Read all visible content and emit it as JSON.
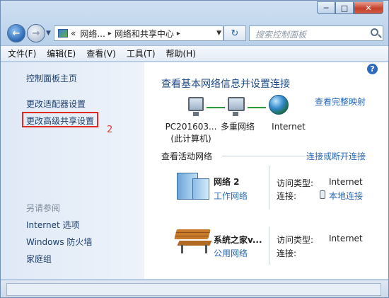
{
  "window": {
    "min_glyph": "─",
    "max_glyph": "□",
    "close_glyph": "✕"
  },
  "nav": {
    "back_glyph": "←",
    "forward_glyph": "→",
    "refresh_glyph": "↻",
    "breadcrumb_prefix": "«",
    "breadcrumb": [
      "网络...",
      "网络和共享中心"
    ],
    "breadcrumb_sep": "▸",
    "search_placeholder": "搜索控制面板"
  },
  "menu": [
    "文件(F)",
    "编辑(E)",
    "查看(V)",
    "工具(T)",
    "帮助(H)"
  ],
  "sidebar": {
    "home": "控制面板主页",
    "links": [
      "更改适配器设置",
      "更改高级共享设置"
    ],
    "annotation": "2",
    "see_also_heading": "另请参阅",
    "see_also": [
      "Internet 选项",
      "Windows 防火墙",
      "家庭组"
    ]
  },
  "main": {
    "help_glyph": "?",
    "heading": "查看基本网络信息并设置连接",
    "full_map_link": "查看完整映射",
    "map_nodes": [
      {
        "line1": "PC201603...",
        "line2": "(此计算机)"
      },
      {
        "line1": "多重网络",
        "line2": ""
      },
      {
        "line1": "Internet",
        "line2": ""
      }
    ],
    "active_label": "查看活动网络",
    "connect_link": "连接或断开连接",
    "networks": [
      {
        "name": "网络  2",
        "type_link": "工作网络",
        "access_label": "访问类型:",
        "access_value": "Internet",
        "conn_label": "连接:",
        "conn_value": "本地连接",
        "icon": "building-icon"
      },
      {
        "name": "系统之家v...",
        "type_link": "公用网络",
        "access_label": "访问类型:",
        "access_value": "Internet",
        "conn_label": "连接:",
        "conn_value": "",
        "icon": "bench-icon"
      }
    ]
  },
  "colors": {
    "link": "#2c69b5",
    "heading": "#1e4a86",
    "highlight_box": "#e02b22"
  }
}
